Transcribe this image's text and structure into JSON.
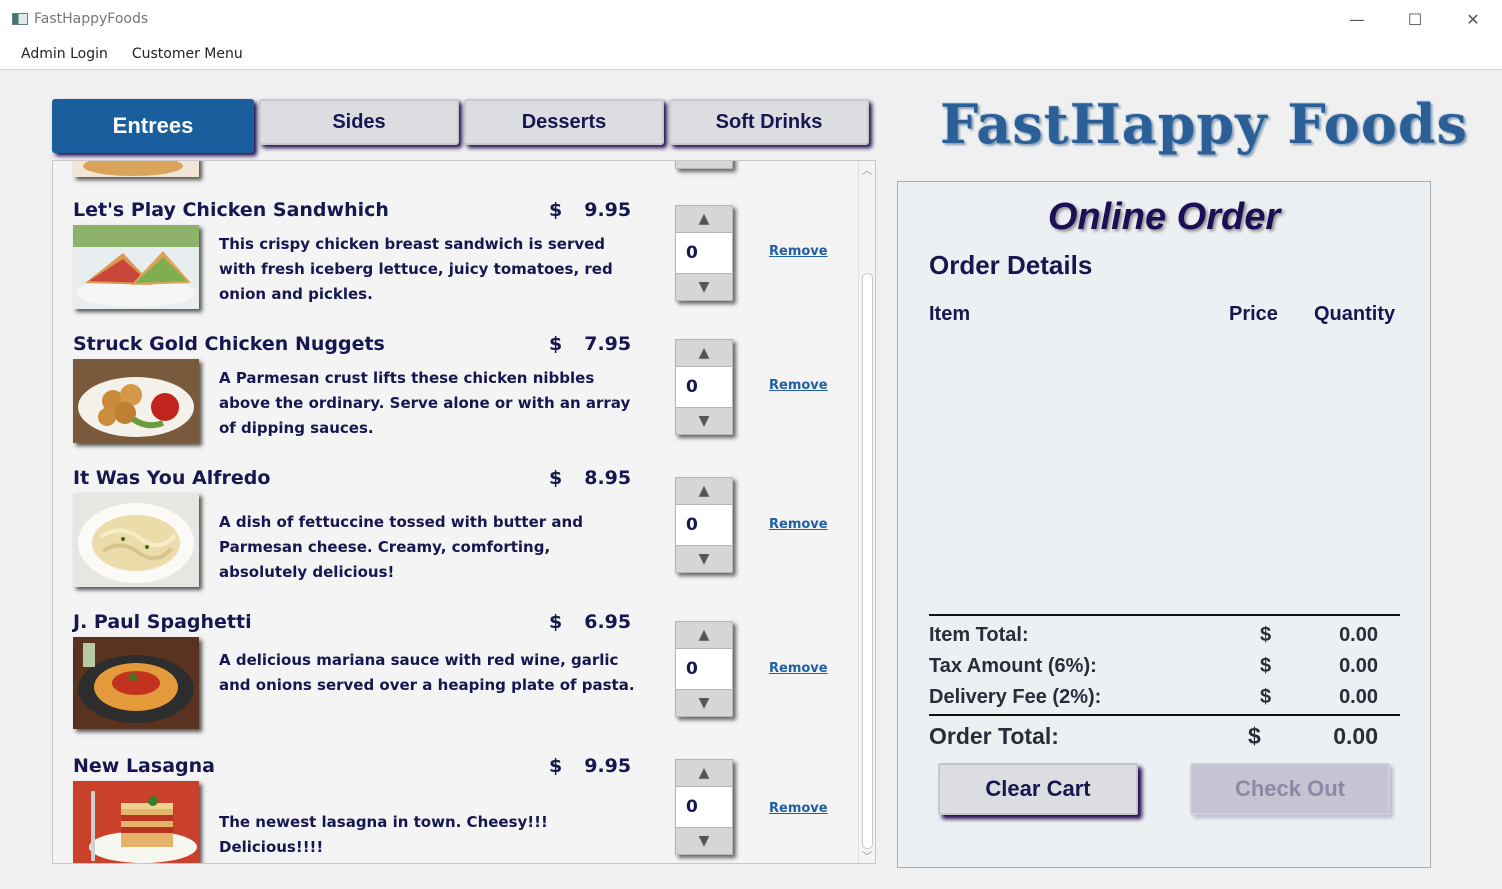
{
  "window": {
    "title": "FastHappyFoods",
    "minimize": "—",
    "maximize": "☐",
    "close": "✕"
  },
  "menubar": [
    "Admin Login",
    "Customer Menu"
  ],
  "tabs": [
    {
      "label": "Entrees",
      "active": true
    },
    {
      "label": "Sides",
      "active": false
    },
    {
      "label": "Desserts",
      "active": false
    },
    {
      "label": "Soft Drinks",
      "active": false
    }
  ],
  "logo_text": "FastHappy Foods",
  "menu_items": [
    {
      "name": "Let's Play Chicken Sandwhich",
      "currency": "$",
      "price": "9.95",
      "description": "This crispy chicken breast sandwich is served with fresh iceberg lettuce, juicy tomatoes, red onion and pickles.",
      "quantity": "0",
      "remove_label": "Remove"
    },
    {
      "name": "Struck Gold Chicken Nuggets",
      "currency": "$",
      "price": "7.95",
      "description": "A Parmesan crust lifts these chicken nibbles above the ordinary. Serve alone or with an array of dipping sauces.",
      "quantity": "0",
      "remove_label": "Remove"
    },
    {
      "name": "It Was You Alfredo",
      "currency": "$",
      "price": "8.95",
      "description": "A dish of fettuccine tossed with butter and Parmesan cheese. Creamy, comforting, absolutely delicious!",
      "quantity": "0",
      "remove_label": "Remove"
    },
    {
      "name": "J. Paul Spaghetti",
      "currency": "$",
      "price": "6.95",
      "description": "A delicious mariana sauce with red wine, garlic and onions served over a heaping plate of pasta.",
      "quantity": "0",
      "remove_label": "Remove"
    },
    {
      "name": "New Lasagna",
      "currency": "$",
      "price": "9.95",
      "description": "The newest lasagna in town.  Cheesy!!! Delicious!!!!",
      "quantity": "0",
      "remove_label": "Remove"
    }
  ],
  "order": {
    "title": "Online Order",
    "details_heading": "Order Details",
    "columns": {
      "item": "Item",
      "price": "Price",
      "quantity": "Quantity"
    },
    "item_total_label": "Item Total:",
    "tax_label": "Tax Amount (6%):",
    "delivery_label": "Delivery Fee (2%):",
    "order_total_label": "Order Total:",
    "currency": "$",
    "item_total": "0.00",
    "tax": "0.00",
    "delivery": "0.00",
    "order_total": "0.00",
    "clear_label": "Clear Cart",
    "checkout_label": "Check Out"
  },
  "colors": {
    "accent": "#1a5e9e",
    "text": "#161650",
    "link": "#1f5fa5"
  }
}
